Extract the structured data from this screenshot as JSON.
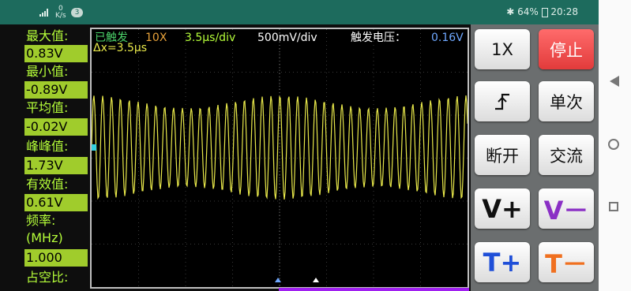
{
  "status": {
    "network_speed_value": "0",
    "network_speed_unit": "K/s",
    "notification_count": "3",
    "battery": "64%",
    "time": "20:28"
  },
  "measurements": [
    {
      "label": "最大值:",
      "value": "0.83V"
    },
    {
      "label": "最小值:",
      "value": "-0.89V"
    },
    {
      "label": "平均值:",
      "value": "-0.02V"
    },
    {
      "label": "峰峰值:",
      "value": "1.73V"
    },
    {
      "label": "有效值:",
      "value": "0.61V"
    },
    {
      "label": "频率:\n(MHz)",
      "value": "1.000"
    },
    {
      "label": "占空比:",
      "value": ""
    }
  ],
  "scope": {
    "trigger_status": "已触发",
    "probe": "10X",
    "timebase": "3.5μs/div",
    "volts_div": "500mV/div",
    "trigger_level_label": "触发电压：",
    "trigger_level_value": "0.16V",
    "delta_x": "Δx=3.5μs",
    "colors": {
      "trace": "#e8e84a",
      "cursor": "#35d0e0",
      "grid": "#3a3a3a",
      "accent_purple": "#a020f0"
    }
  },
  "buttons": {
    "probe": "1X",
    "stop": "停止",
    "edge": "edge-rising-icon",
    "single": "单次",
    "disconnect": "断开",
    "ac": "交流",
    "v_plus": "V+",
    "v_minus": "V－",
    "t_plus": "T+",
    "t_minus": "T－"
  }
}
